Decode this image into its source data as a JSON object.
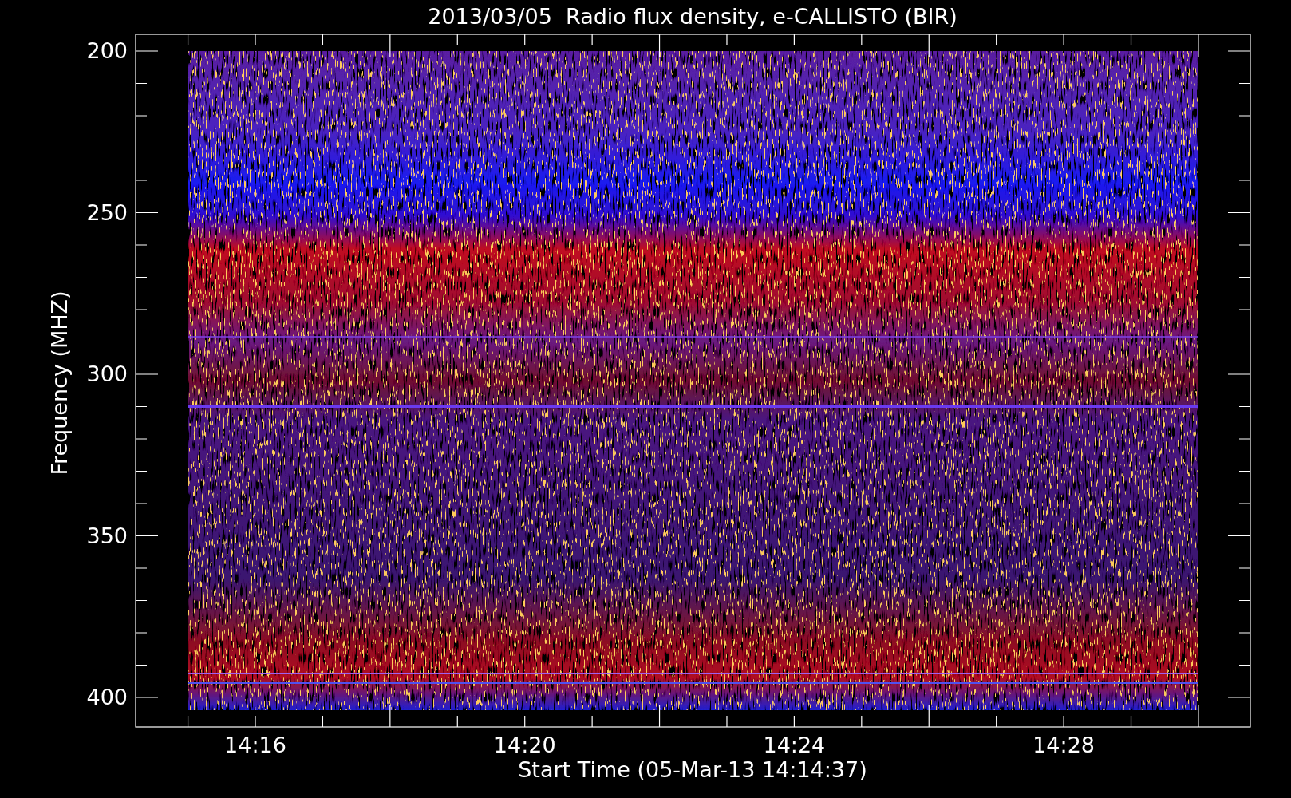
{
  "title": "2013/03/05  Radio flux density, e-CALLISTO (BIR)",
  "y_axis": {
    "label": "Frequency (MHZ)",
    "ticks": [
      "200",
      "250",
      "300",
      "350",
      "400"
    ]
  },
  "x_axis": {
    "label": "Start Time (05-Mar-13 14:14:37)",
    "ticks": [
      "14:16",
      "14:20",
      "14:24",
      "14:28"
    ]
  }
}
